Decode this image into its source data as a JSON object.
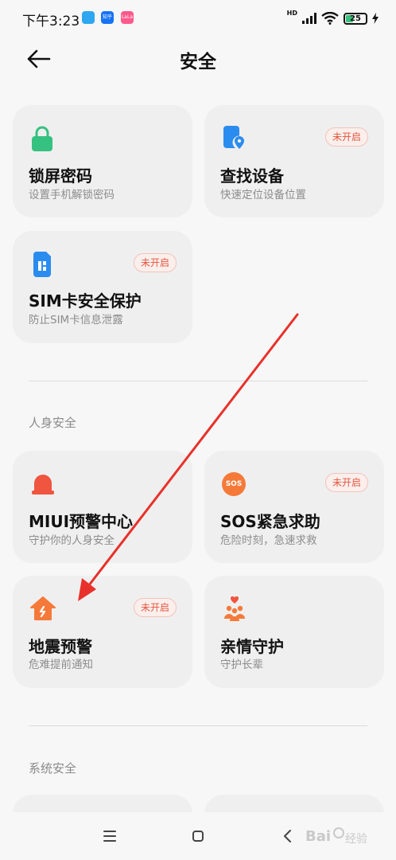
{
  "status_bar": {
    "time": "下午3:23",
    "app_icons": [
      "messages-app",
      "知乎",
      "LaLa"
    ],
    "network": "HD",
    "battery": "25"
  },
  "header": {
    "title": "安全"
  },
  "cards_top": [
    {
      "title": "锁屏密码",
      "subtitle": "设置手机解锁密码",
      "icon": "lock-icon",
      "badge": ""
    },
    {
      "title": "查找设备",
      "subtitle": "快速定位设备位置",
      "icon": "find-device-icon",
      "badge": "未开启"
    },
    {
      "title": "SIM卡安全保护",
      "subtitle": "防止SIM卡信息泄露",
      "icon": "sim-card-icon",
      "badge": "未开启"
    }
  ],
  "sections": {
    "personal_safety": "人身安全",
    "system_safety": "系统安全"
  },
  "cards_personal": [
    {
      "title": "MIUI预警中心",
      "subtitle": "守护你的人身安全",
      "icon": "alarm-icon",
      "badge": ""
    },
    {
      "title": "SOS紧急求助",
      "subtitle": "危险时刻，急速求救",
      "icon": "sos-icon",
      "icon_text": "SOS",
      "badge": "未开启"
    },
    {
      "title": "地震预警",
      "subtitle": "危难提前通知",
      "icon": "earthquake-icon",
      "badge": "未开启"
    },
    {
      "title": "亲情守护",
      "subtitle": "守护长辈",
      "icon": "family-icon",
      "badge": ""
    }
  ],
  "colors": {
    "accent_green": "#35c17f",
    "accent_blue": "#2b8cf0",
    "accent_red": "#f0553f",
    "accent_orange": "#f57a3a",
    "annotation_arrow": "#e8312a"
  },
  "watermark": "Baidu经验"
}
